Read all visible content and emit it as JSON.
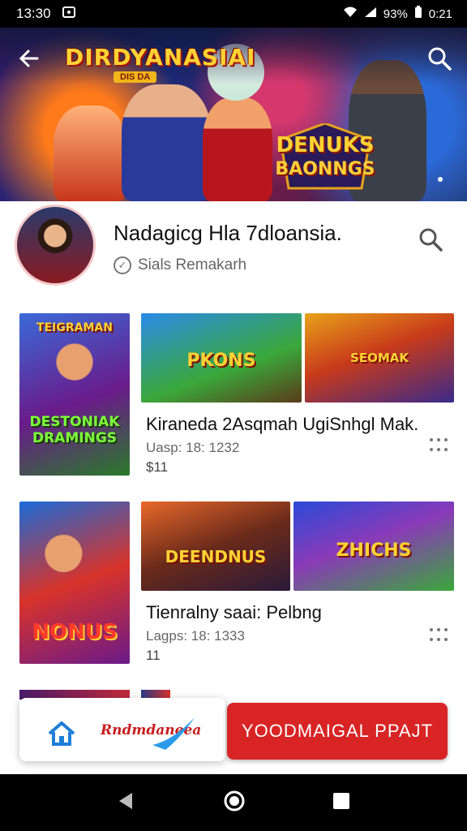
{
  "status_bar": {
    "time": "13:30",
    "battery_text": "93%",
    "clock_right": "0:21"
  },
  "banner": {
    "title": "DIRDYANASIAI",
    "subtitle": "DIS DA",
    "logo_line1": "DENUKS",
    "logo_line2": "BAONNGS"
  },
  "profile": {
    "name": "Nadagicg Hla 7dloansia.",
    "subtitle": "Sials Remakarh"
  },
  "games": [
    {
      "title": "Kiraneda 2Asqmah UgiSnhgl Mak.",
      "meta": "Uasp: 18: 1232",
      "count": "$11",
      "thumb_main": "DESTONIAK DRAMINGS",
      "thumb_main_top": "TEIGRAMAN",
      "thumb_a": "PKONS",
      "thumb_b": "SEOMAK"
    },
    {
      "title": "Tienralny saai: Pelbng",
      "meta": "Lagps: 18: 1333",
      "count": "11",
      "thumb_main": "NONUS",
      "thumb_a": "DEENDNUS",
      "thumb_b": "ZHICHS"
    }
  ],
  "bottom": {
    "brand_text": "Rndmdaneea",
    "cta_label": "YOODMAIGAL PPAJT"
  },
  "colors": {
    "accent": "#d82424",
    "status_bg": "#000000"
  }
}
